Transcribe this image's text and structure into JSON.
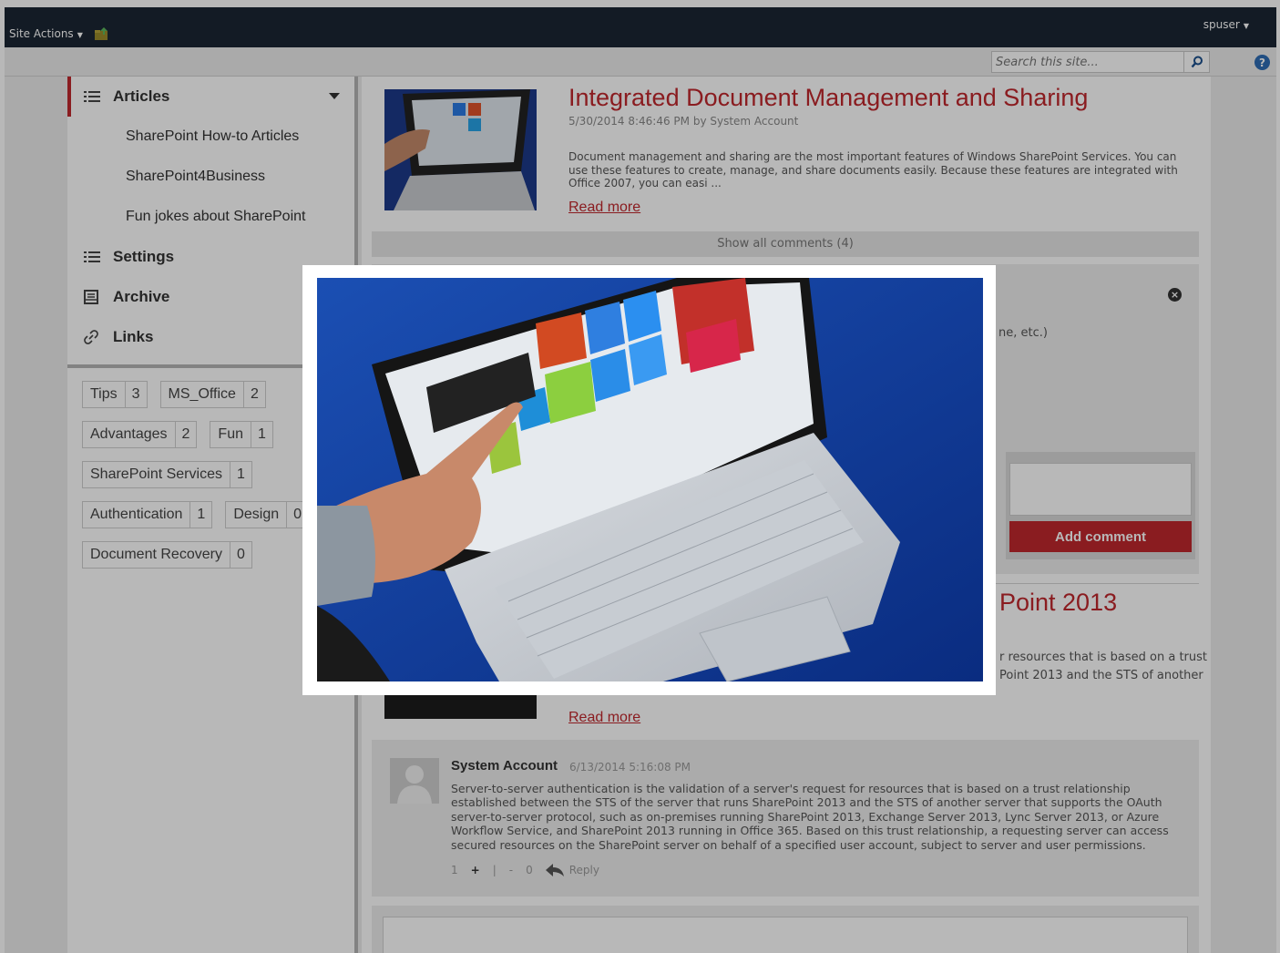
{
  "topbar": {
    "site_actions": "Site Actions",
    "user": "spuser"
  },
  "search": {
    "placeholder": "Search this site..."
  },
  "nav": {
    "articles": "Articles",
    "sub_items": [
      "SharePoint How-to Articles",
      "SharePoint4Business",
      "Fun jokes about SharePoint"
    ],
    "settings": "Settings",
    "archive": "Archive",
    "links": "Links"
  },
  "tags": [
    {
      "name": "Tips",
      "count": "3"
    },
    {
      "name": "MS_Office",
      "count": "2"
    },
    {
      "name": "Advantages",
      "count": "2"
    },
    {
      "name": "Fun",
      "count": "1"
    },
    {
      "name": "SharePoint Services",
      "count": "1"
    },
    {
      "name": "Authentication",
      "count": "1"
    },
    {
      "name": "Design",
      "count": "0"
    },
    {
      "name": "Document Recovery",
      "count": "0"
    }
  ],
  "post1": {
    "title": "Integrated Document Management and Sharing",
    "meta": "5/30/2014 8:46:46 PM by System Account",
    "excerpt": "Document management and sharing are the most important features of Windows SharePoint Services. You can use these features to create,  manage, and share documents easily. Because these features are integrated with Office 2007, you can easi ...",
    "read_more": "Read more",
    "show_comments": "Show all comments (4)"
  },
  "comment_block": {
    "fragment": "ne, etc.)",
    "add_comment": "Add comment"
  },
  "post2": {
    "title_fragment": "Point 2013",
    "excerpt_fragment_1": "r resources that is based on a trust",
    "excerpt_fragment_2": "Point 2013 and the STS of another",
    "read_more": "Read more"
  },
  "comment2": {
    "author": "System Account",
    "date": "6/13/2014 5:16:08 PM",
    "body": "Server-to-server authentication is the validation of a server's request for resources that is based on a trust relationship established between the STS of the server that runs SharePoint 2013 and the STS of another server that supports the OAuth server-to-server protocol, such as on-premises running SharePoint 2013, Exchange Server 2013, Lync Server 2013, or Azure Workflow Service, and SharePoint 2013 running in Office 365. Based on this trust relationship, a requesting server can access secured resources on the SharePoint server on behalf of a specified user account, subject to server and user permissions.",
    "likes": "1",
    "plus": "+",
    "sep": "|",
    "minus": "-",
    "dislikes": "0",
    "reply": "Reply"
  },
  "icons": {
    "nav_list": "list-icon",
    "archive": "archive-icon",
    "links": "link-icon",
    "search": "search-icon",
    "help": "help-icon",
    "close": "close-icon",
    "reply": "reply-icon"
  },
  "colors": {
    "accent": "#c0282d",
    "topbar": "#1b2634",
    "help": "#2e6db4"
  }
}
